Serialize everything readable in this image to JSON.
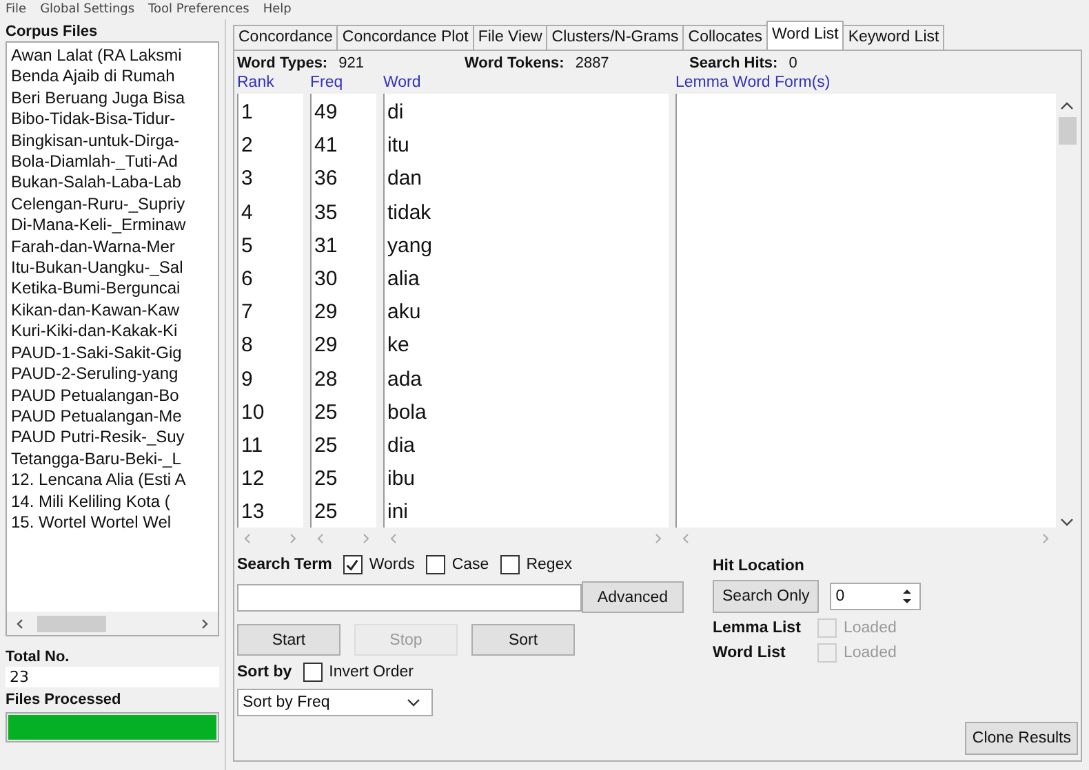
{
  "menu": [
    "File",
    "Global Settings",
    "Tool Preferences",
    "Help"
  ],
  "corpus": {
    "title": "Corpus Files",
    "files": [
      "Awan Lalat (RA Laksmi",
      "Benda Ajaib di Rumah",
      "Beri Beruang Juga Bisa",
      "Bibo-Tidak-Bisa-Tidur-",
      "Bingkisan-untuk-Dirga-",
      "Bola-Diamlah-_Tuti-Ad",
      "Bukan-Salah-Laba-Lab",
      "Celengan-Ruru-_Supriy",
      "Di-Mana-Keli-_Erminaw",
      "Farah-dan-Warna-Mer",
      "Itu-Bukan-Uangku-_Sal",
      "Ketika-Bumi-Berguncai",
      "Kikan-dan-Kawan-Kaw",
      "Kuri-Kiki-dan-Kakak-Ki",
      "PAUD-1-Saki-Sakit-Gig",
      "PAUD-2-Seruling-yang",
      "PAUD Petualangan-Bo",
      "PAUD Petualangan-Me",
      "PAUD Putri-Resik-_Suy",
      "Tetangga-Baru-Beki-_L",
      "12. Lencana Alia (Esti A",
      "14. Mili Keliling Kota  (",
      "15. Wortel Wortel Wel"
    ],
    "total_label": "Total No.",
    "total": "23",
    "processed_label": "Files Processed",
    "progress": {
      "level": 1
    }
  },
  "tabs": [
    {
      "label": "Concordance",
      "selected": false
    },
    {
      "label": "Concordance Plot",
      "selected": false
    },
    {
      "label": "File View",
      "selected": false
    },
    {
      "label": "Clusters/N-Grams",
      "selected": false
    },
    {
      "label": "Collocates",
      "selected": false
    },
    {
      "label": "Word List",
      "selected": true
    },
    {
      "label": "Keyword List",
      "selected": false
    }
  ],
  "stats": [
    {
      "label": "Word Types:",
      "value": "921"
    },
    {
      "label": "Word Tokens:",
      "value": "2887"
    },
    {
      "label": "Search Hits:",
      "value": "0"
    }
  ],
  "columns": [
    "Rank",
    "Freq",
    "Word",
    "Lemma Word Form(s)"
  ],
  "rows": [
    [
      "1",
      "49",
      "di"
    ],
    [
      "2",
      "41",
      "itu"
    ],
    [
      "3",
      "36",
      "dan"
    ],
    [
      "4",
      "35",
      "tidak"
    ],
    [
      "5",
      "31",
      "yang"
    ],
    [
      "6",
      "30",
      "alia"
    ],
    [
      "7",
      "29",
      "aku"
    ],
    [
      "8",
      "29",
      "ke"
    ],
    [
      "9",
      "28",
      "ada"
    ],
    [
      "10",
      "25",
      "bola"
    ],
    [
      "11",
      "25",
      "dia"
    ],
    [
      "12",
      "25",
      "ibu"
    ],
    [
      "13",
      "25",
      "ini"
    ]
  ],
  "search": {
    "label": "Search Term",
    "options": [
      {
        "label": "Words",
        "checked": true
      },
      {
        "label": "Case",
        "checked": false
      },
      {
        "label": "Regex",
        "checked": false
      }
    ],
    "advanced": "Advanced"
  },
  "actions": [
    {
      "label": "Start",
      "disabled": false
    },
    {
      "label": "Stop",
      "disabled": true
    },
    {
      "label": "Sort",
      "disabled": false
    }
  ],
  "sort": {
    "label": "Sort by",
    "invert": {
      "label": "Invert Order",
      "checked": false
    },
    "value": "Sort by Freq"
  },
  "hit": {
    "label": "Hit Location",
    "button": "Search Only",
    "value": "0"
  },
  "lists": [
    {
      "label": "Lemma List",
      "check": "Loaded",
      "checked": false
    },
    {
      "label": "Word List",
      "check": "Loaded",
      "checked": false
    }
  ],
  "clone": "Clone Results"
}
